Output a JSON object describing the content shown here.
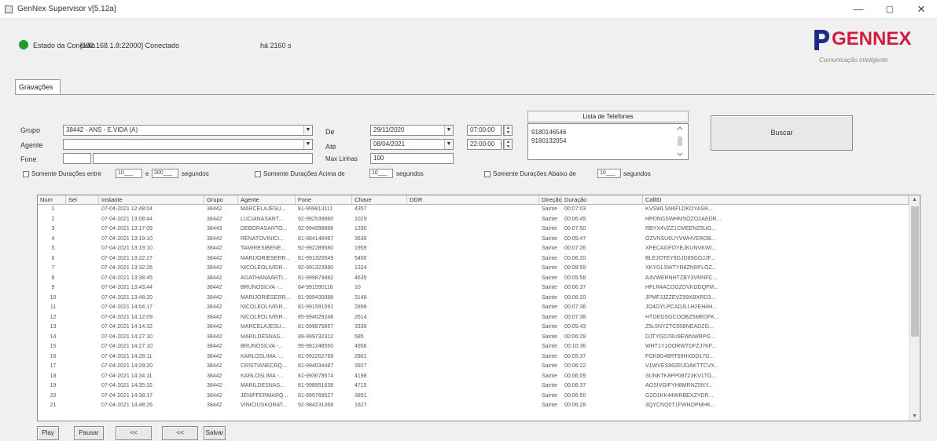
{
  "window": {
    "title": "GenNex Supervisor v[5.12a]",
    "min_glyph": "—",
    "max_glyph": "▢",
    "close_glyph": "✕"
  },
  "connection": {
    "label": "Estado da Conexão",
    "value": "[192.168.1.8:22000] Conectado",
    "elapsed": "há 2160 s",
    "status_color": "#1e9c2c"
  },
  "logo": {
    "text": "GENNEX",
    "tagline": "Comunicação inteligente",
    "brand_color": "#d11c3f"
  },
  "tab": {
    "label": "Gravações"
  },
  "form": {
    "grupo_label": "Grupo",
    "grupo_value": "38442 - ANS - E.VIDA (A)",
    "agente_label": "Agente",
    "agente_value": "",
    "fone_label": "Fone",
    "fone_value": "",
    "de_label": "De",
    "de_date": "29/11/2020",
    "de_time": "07:00:00",
    "ate_label": "Até",
    "ate_date": "08/04/2021",
    "ate_time": "22:00:00",
    "max_linhas_label": "Max Linhas",
    "max_linhas_value": "100",
    "chk_entre_label": "Somente Durações entre",
    "entre_min": "10___",
    "entre_e": "e",
    "entre_max": "300___",
    "entre_unit": "segundos",
    "chk_acima_label": "Somente Durações Acima de",
    "acima_value": "10___",
    "acima_unit": "segundos",
    "chk_abaixo_label": "Somente Durações Abaixo de",
    "abaixo_value": "10___",
    "abaixo_unit": "segundos",
    "phone_list_title": "Lista de Telefones",
    "phones": [
      "9180146546",
      "9180132054"
    ],
    "buscar_label": "Buscar"
  },
  "grid": {
    "headers": [
      "Num",
      "Sel",
      "Instante",
      "Grupo",
      "Agente",
      "Fone",
      "Chave",
      "DDR",
      "Direção",
      "Duração",
      "CallID"
    ],
    "rows": [
      [
        "1",
        "",
        "07-04-2021 12:48:04",
        "38442",
        "MARCELAJESU...",
        "81-999813111",
        "4357",
        "",
        "Sainte",
        "00:07:03",
        "KVSWLSN6FLDKOYASR..."
      ],
      [
        "2",
        "",
        "07-04-2021 13:08:44",
        "38442",
        "LUCIANASANT...",
        "92-992539880",
        "1029",
        "",
        "Sainte",
        "00:06:49",
        "HPDNGSWHMSOZO2AEDR..."
      ],
      [
        "3",
        "",
        "07-04-2021 13:17:09",
        "38443",
        "DEBORASANTO...",
        "92-994998888",
        "1330",
        "",
        "Sainte",
        "00:07:50",
        "RBYX4VZZ1CMEENZ5UG..."
      ],
      [
        "4",
        "",
        "07-04-2021 13:19:10",
        "38442",
        "RENATOVINICI...",
        "81-984148487",
        "3639",
        "",
        "Sainte",
        "00:05:47",
        "OZVNSU6UYVWHVEROB..."
      ],
      [
        "5",
        "",
        "07-04-2021 13:19:10",
        "38442",
        "TAMIRESIBENE...",
        "92-992289580",
        "1959",
        "",
        "Sainte",
        "00:07:26",
        "XPECAGFOYEJKUNVKWI..."
      ],
      [
        "6",
        "",
        "07-04-2021 13:22:27",
        "38442",
        "MARIJORIESERR...",
        "81-991320549",
        "5400",
        "",
        "Sainte",
        "00:06:20",
        "BLEJOTEY9GJD89GOJJF..."
      ],
      [
        "7",
        "",
        "07-04-2021 13:32:26",
        "38442",
        "NICOLEOLIVEIR...",
        "92-991323980",
        "1324",
        "",
        "Sainte",
        "00:08:59",
        "XKYGLSWTYR8ZNRFLOZ..."
      ],
      [
        "8",
        "",
        "07-04-2021 13:38:45",
        "38442",
        "AGATHANAARTI...",
        "81-999879882",
        "4635",
        "",
        "Sainte",
        "00:05:58",
        "A3VWERNHTZBY3VRNFC..."
      ],
      [
        "9",
        "",
        "07-04-2021 13:43:44",
        "38442",
        "BRUNOSILVA -...",
        "84-991590118",
        "10",
        "",
        "Sainte",
        "00:06:37",
        "HFLR4ACOGZDVKDDQFM..."
      ],
      [
        "10",
        "",
        "07-04-2021 13:48:20",
        "38442",
        "MARIJORIESERR...",
        "81-999430088",
        "3148",
        "",
        "Sainte",
        "00:06:20",
        "JPMFJJZZEVZ99XBXRD3..."
      ],
      [
        "11",
        "",
        "07-04-2021 14:04:17",
        "38442",
        "NICOLEOLIVEIR...",
        "81-991591591",
        "2898",
        "",
        "Sainte",
        "00:07:36",
        "JO4GYLPCADJLLH2EH4H..."
      ],
      [
        "12",
        "",
        "07-04-2021 14:12:09",
        "38442",
        "NICOLEOLIVEIR...",
        "85-994029248",
        "2614",
        "",
        "Sainte",
        "00:07:38",
        "HTGEDSGCOOBZ5MEDFK..."
      ],
      [
        "13",
        "",
        "07-04-2021 14:14:32",
        "38442",
        "MARCELAJESU...",
        "81-999875857",
        "3339",
        "",
        "Sainte",
        "00:05:43",
        "Z5L5NYZTC55BNEADZG..."
      ],
      [
        "14",
        "",
        "07-04-2021 14:27:10",
        "38442",
        "MARILDESNAS...",
        "89-999732312",
        "585",
        "",
        "Sainte",
        "00:06:29",
        "DJTYGD78U9EWNWRPG..."
      ],
      [
        "15",
        "",
        "07-04-2021 14:27:10",
        "38442",
        "BRUNOSILVA -...",
        "95-991248550",
        "4958",
        "",
        "Sainte",
        "00:10:36",
        "WHT1Y1OORWTDFZJ7KF..."
      ],
      [
        "16",
        "",
        "07-04-2021 14:28:11",
        "38442",
        "KARLOSLIMA -...",
        "81-992262769",
        "2801",
        "",
        "Sainte",
        "00:05:37",
        "FGK8G48RT69HXDD17G..."
      ],
      [
        "17",
        "",
        "07-04-2021 14:28:20",
        "38442",
        "CRISTIANECRQ...",
        "81-994034487",
        "3927",
        "",
        "Sainte",
        "00:06:22",
        "V1WVES962EUDAKTTCVX..."
      ],
      [
        "18",
        "",
        "07-04-2021 14:34:11",
        "38442",
        "KARLOSLIMA -...",
        "81-993679574",
        "4198",
        "",
        "Sainte",
        "00:06:09",
        "SUNKTK8PP08T23KV1TG..."
      ],
      [
        "19",
        "",
        "07-04-2021 14:35:32",
        "38442",
        "MARILDESNAS...",
        "81-998851638",
        "4715",
        "",
        "Sainte",
        "00:06:37",
        "AOSIVGIFYH8MRNZ5NY..."
      ],
      [
        "20",
        "",
        "07-04-2021 14:38:17",
        "38442",
        "JENIFFERMARQ...",
        "81-999769527",
        "3851",
        "",
        "Sainte",
        "00:06:50",
        "G2O1KK44WRBEXZYDR..."
      ],
      [
        "21",
        "",
        "07-04-2021 14:48:26",
        "38442",
        "VINICIUSKORAT...",
        "92-984231068",
        "1627",
        "",
        "Sainte",
        "00:06:28",
        "3QYCNQ0T1FWNOPMHK..."
      ]
    ]
  },
  "player": {
    "play_label": "Play",
    "pause_label": "Pausar",
    "rewind_label": "<<",
    "back_label": "<<",
    "save_label": "Salvar"
  }
}
